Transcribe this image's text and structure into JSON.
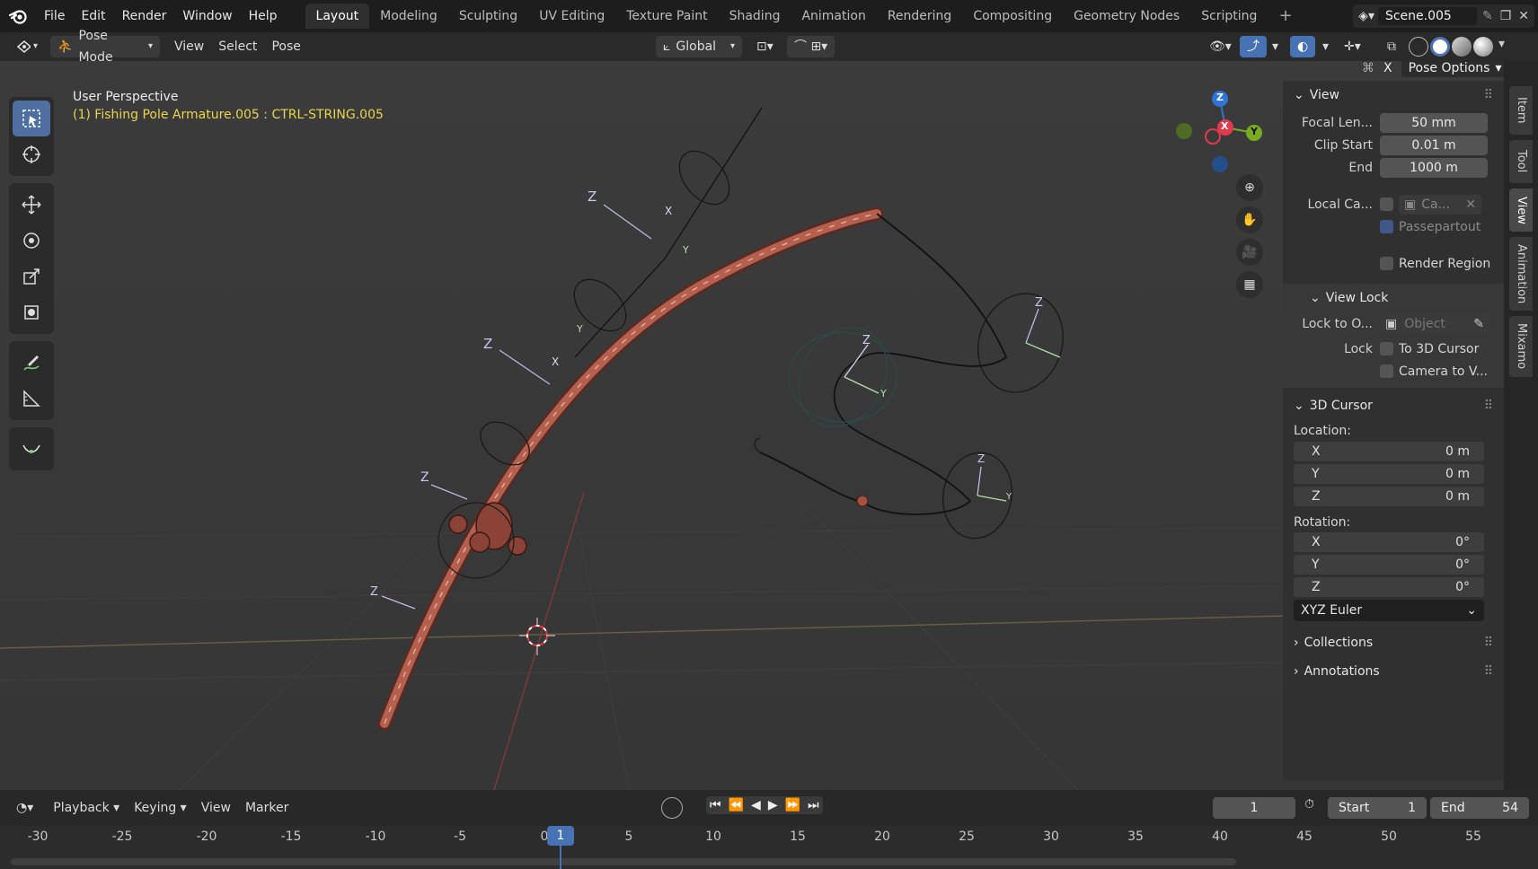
{
  "topbar": {
    "menus": [
      "File",
      "Edit",
      "Render",
      "Window",
      "Help"
    ],
    "workspaces": [
      "Layout",
      "Modeling",
      "Sculpting",
      "UV Editing",
      "Texture Paint",
      "Shading",
      "Animation",
      "Rendering",
      "Compositing",
      "Geometry Nodes",
      "Scripting"
    ],
    "active_workspace": "Layout",
    "add_tab": "+",
    "scene": "Scene.005"
  },
  "header": {
    "mode": "Pose Mode",
    "menus": [
      "View",
      "Select",
      "Pose"
    ],
    "orientation": "Global",
    "pose_options": "Pose Options",
    "x_toggle": "X"
  },
  "viewport": {
    "perspective": "User Perspective",
    "object_info": "(1) Fishing Pole Armature.005 : CTRL-STRING.005",
    "gizmo": {
      "x": "X",
      "y": "Y",
      "z": "Z"
    },
    "bone_labels": [
      "Z",
      "Z",
      "Z",
      "Z",
      "Z",
      "Z",
      "Z",
      "Y",
      "Y",
      "Y",
      "Y",
      "X",
      "X"
    ]
  },
  "npanel": {
    "view": {
      "title": "View",
      "focal_label": "Focal Len...",
      "focal_value": "50 mm",
      "clip_start_label": "Clip Start",
      "clip_start_value": "0.01 m",
      "clip_end_label": "End",
      "clip_end_value": "1000 m",
      "local_camera_label": "Local Ca...",
      "local_camera_value": "Ca...",
      "passepartout": "Passepartout",
      "render_region": "Render Region"
    },
    "view_lock": {
      "title": "View Lock",
      "lock_to_object_label": "Lock to O...",
      "lock_to_object_placeholder": "Object",
      "lock_label": "Lock",
      "to_3d_cursor": "To 3D Cursor",
      "camera_to_view": "Camera to V..."
    },
    "cursor": {
      "title": "3D Cursor",
      "location_label": "Location:",
      "location": [
        {
          "axis": "X",
          "value": "0 m"
        },
        {
          "axis": "Y",
          "value": "0 m"
        },
        {
          "axis": "Z",
          "value": "0 m"
        }
      ],
      "rotation_label": "Rotation:",
      "rotation": [
        {
          "axis": "X",
          "value": "0°"
        },
        {
          "axis": "Y",
          "value": "0°"
        },
        {
          "axis": "Z",
          "value": "0°"
        }
      ],
      "rotation_mode": "XYZ Euler"
    },
    "collections": "Collections",
    "annotations": "Annotations",
    "tabs": [
      "Item",
      "Tool",
      "View",
      "Animation",
      "Mixamo"
    ],
    "active_tab": "View"
  },
  "timeline": {
    "menus": [
      "Playback",
      "Keying",
      "View",
      "Marker"
    ],
    "current_frame": "1",
    "start_label": "Start",
    "start_value": "1",
    "end_label": "End",
    "end_value": "54",
    "ruler_ticks": [
      "-30",
      "-25",
      "-20",
      "-15",
      "-10",
      "-5",
      "0",
      "5",
      "10",
      "15",
      "20",
      "25",
      "30",
      "35",
      "40",
      "45",
      "50",
      "55"
    ],
    "playhead": "1"
  },
  "colors": {
    "accent": "#4772b3",
    "pole": "#b05a4a",
    "info_text": "#e8d44d",
    "gizmo_x": "#e23a4d",
    "gizmo_y": "#7aaa1f",
    "gizmo_z": "#2e73d6"
  }
}
